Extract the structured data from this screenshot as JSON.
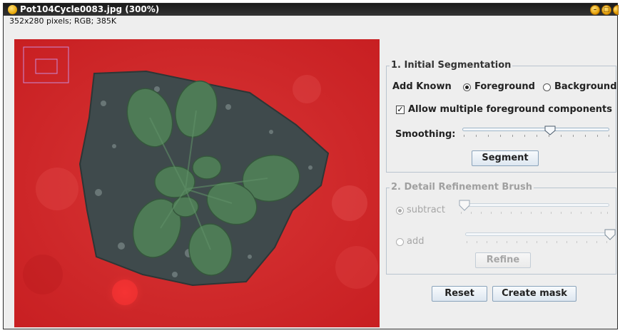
{
  "window": {
    "title": "Pot104Cycle0083.jpg (300%)",
    "info": "352x280 pixels; RGB; 385K"
  },
  "panel": {
    "initial_segmentation": {
      "title": "1. Initial Segmentation",
      "add_known_label": "Add Known",
      "foreground_label": "Foreground",
      "background_label": "Background",
      "selected": "Foreground",
      "allow_multiple_label": "Allow multiple foreground components",
      "allow_multiple_checked": true,
      "smoothing_label": "Smoothing:",
      "smoothing_value": 0.58,
      "segment_button": "Segment"
    },
    "detail_refinement": {
      "title": "2. Detail Refinement Brush",
      "subtract_label": "subtract",
      "add_label": "add",
      "selected": "subtract",
      "subtract_value": 0.0,
      "add_value": 1.0,
      "refine_button": "Refine"
    },
    "reset_button": "Reset",
    "create_mask_button": "Create mask"
  },
  "colors": {
    "overlay_red": "#d42a2a",
    "leaf_green": "#4f7d56",
    "soil_dark": "#3d4a4a"
  },
  "icons": [
    "app-icon",
    "minimize-icon",
    "maximize-icon",
    "close-icon",
    "navigator-rect"
  ]
}
